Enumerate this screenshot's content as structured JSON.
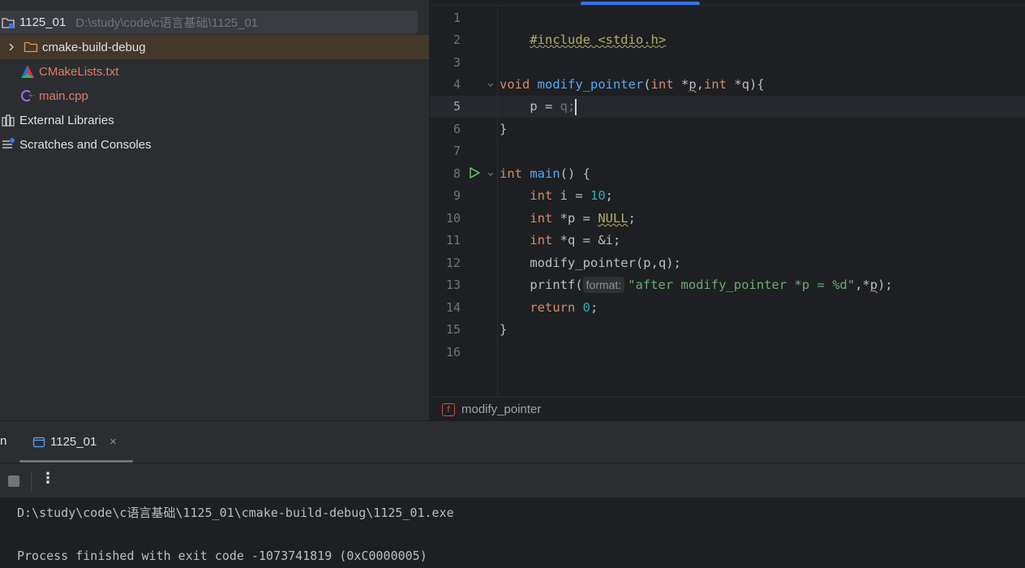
{
  "project": {
    "root_name": "1125_01",
    "root_path": "D:\\study\\code\\c语言基础\\1125_01",
    "items": [
      {
        "label": "cmake-build-debug",
        "icon": "folder-icon",
        "expandable": true
      },
      {
        "label": "CMakeLists.txt",
        "icon": "cmake-file-icon"
      },
      {
        "label": "main.cpp",
        "icon": "cpp-file-icon"
      },
      {
        "label": "External Libraries",
        "icon": "external-libraries-icon"
      },
      {
        "label": "Scratches and Consoles",
        "icon": "scratches-icon"
      }
    ]
  },
  "editor": {
    "line_numbers": [
      "1",
      "2",
      "3",
      "4",
      "5",
      "6",
      "7",
      "8",
      "9",
      "10",
      "11",
      "12",
      "13",
      "14",
      "15",
      "16"
    ],
    "current_line": 5,
    "code": {
      "l1": "#include <stdio.h>",
      "l4_void": "void",
      "l4_fn": "modify_pointer",
      "l4_open": "(",
      "l4_int1": "int",
      "l4_p1": " *",
      "l4_p1b": "p",
      "l4_comma": ",",
      "l4_int2": "int",
      "l4_q": " *q){",
      "l5": "    p = ",
      "l5_q": "q",
      "l5_semi": ";",
      "l6": "}",
      "l8_int": "int",
      "l8_main": "main",
      "l8_rest": "() {",
      "l9_indent": "    ",
      "l9_int": "int",
      "l9_mid": " i = ",
      "l9_num": "10",
      "l9_end": ";",
      "l10_int": "int",
      "l10_mid": " *p = ",
      "l10_null": "NULL",
      "l10_end": ";",
      "l11_int": "int",
      "l11_rest": " *q = &i;",
      "l12": "    modify_pointer(p,q);",
      "l13_a": "    printf(",
      "l13_hint": "format:",
      "l13_str": "\"after modify_pointer *p = %d\"",
      "l13_b": ",*",
      "l13_p": "p",
      "l13_c": ");",
      "l14_ret": "return",
      "l14_num": "0",
      "l14_end": ";",
      "l15": "}"
    },
    "breadcrumb": {
      "badge": "f",
      "label": "modify_pointer"
    }
  },
  "run": {
    "title_fragment": "n",
    "tab_label": "1125_01",
    "tab_close": "×",
    "more_label": "⋮",
    "console_lines": [
      "D:\\study\\code\\c语言基础\\1125_01\\cmake-build-debug\\1125_01.exe",
      "",
      "Process finished with exit code -1073741819 (0xC0000005)"
    ]
  },
  "colors": {
    "accent": "#3574f0",
    "keyword": "#cf8e6d",
    "function": "#56a8f5",
    "number": "#2aacb8",
    "string": "#6aab73",
    "macro": "#b3ae60",
    "error_file": "#e07b6a",
    "run_green": "#5fb865"
  }
}
